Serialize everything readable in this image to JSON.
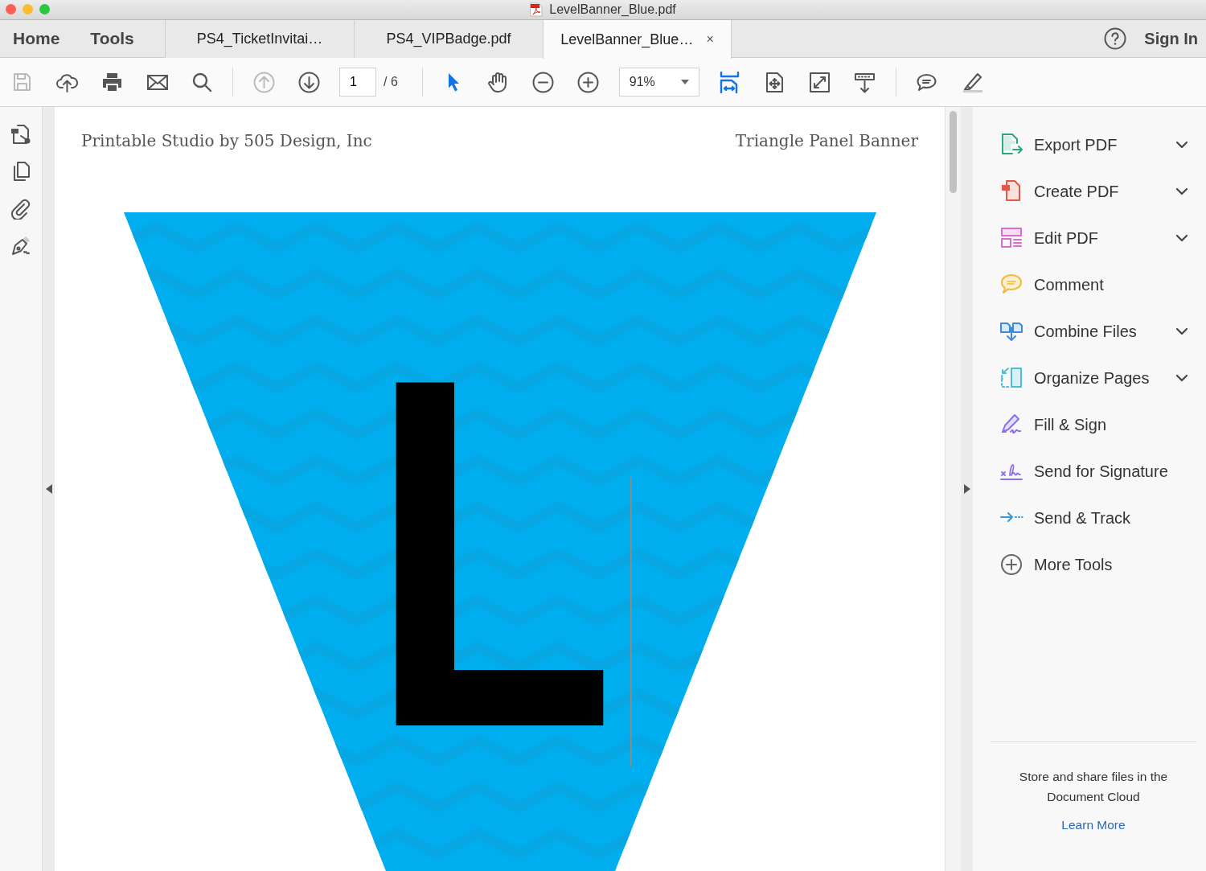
{
  "window": {
    "title": "LevelBanner_Blue.pdf"
  },
  "nav": [
    {
      "label": "Home"
    },
    {
      "label": "Tools"
    }
  ],
  "tabs": [
    {
      "label": "PS4_TicketInvitai…",
      "selected": false,
      "closable": false
    },
    {
      "label": "PS4_VIPBadge.pdf",
      "selected": false,
      "closable": false
    },
    {
      "label": "LevelBanner_Blue…",
      "selected": true,
      "closable": true,
      "close": "×"
    }
  ],
  "account": {
    "sign_in": "Sign In"
  },
  "toolbar": [
    {
      "kind": "save",
      "disabled": true,
      "selected": false
    },
    {
      "kind": "upload",
      "disabled": false,
      "selected": false
    },
    {
      "kind": "print",
      "disabled": false,
      "selected": false
    },
    {
      "kind": "mail",
      "disabled": false,
      "selected": false
    },
    {
      "kind": "search",
      "disabled": false,
      "selected": false
    },
    {
      "kind": "separator"
    },
    {
      "kind": "page_up",
      "disabled": true,
      "selected": false
    },
    {
      "kind": "page_down",
      "disabled": false,
      "selected": false
    },
    {
      "kind": "page_field",
      "value": "1",
      "total": "/ 6"
    },
    {
      "kind": "separator"
    },
    {
      "kind": "pointer",
      "disabled": false,
      "selected": true
    },
    {
      "kind": "hand",
      "disabled": false,
      "selected": false
    },
    {
      "kind": "zoom_out",
      "disabled": false,
      "selected": false
    },
    {
      "kind": "zoom_in",
      "disabled": false,
      "selected": false
    },
    {
      "kind": "zoom_field",
      "value": "91%"
    },
    {
      "kind": "fit_width",
      "disabled": false,
      "selected": true
    },
    {
      "kind": "fit_page",
      "disabled": false,
      "selected": false
    },
    {
      "kind": "full_screen",
      "disabled": false,
      "selected": false
    },
    {
      "kind": "scroll_mode",
      "disabled": false,
      "selected": false
    },
    {
      "kind": "separator"
    },
    {
      "kind": "comment",
      "disabled": false,
      "selected": false
    },
    {
      "kind": "highlight",
      "disabled": false,
      "selected": false
    }
  ],
  "document": {
    "header_left": "Printable Studio by 505 Design, Inc",
    "header_right": "Triangle Panel Banner",
    "letter": "L"
  },
  "tools": [
    {
      "kind": "export",
      "label": "Export PDF",
      "has_menu": true
    },
    {
      "kind": "create",
      "label": "Create PDF",
      "has_menu": true
    },
    {
      "kind": "edit",
      "label": "Edit PDF",
      "has_menu": true
    },
    {
      "kind": "comment",
      "label": "Comment",
      "has_menu": false
    },
    {
      "kind": "combine",
      "label": "Combine Files",
      "has_menu": true
    },
    {
      "kind": "organize",
      "label": "Organize Pages",
      "has_menu": true
    },
    {
      "kind": "fill_sign",
      "label": "Fill & Sign",
      "has_menu": false
    },
    {
      "kind": "send_signature",
      "label": "Send for Signature",
      "has_menu": false
    },
    {
      "kind": "send_track",
      "label": "Send & Track",
      "has_menu": false
    },
    {
      "kind": "more",
      "label": "More Tools",
      "has_menu": false
    }
  ],
  "cloud_promo": {
    "text": "Store and share files in the Document Cloud",
    "link": "Learn More"
  }
}
